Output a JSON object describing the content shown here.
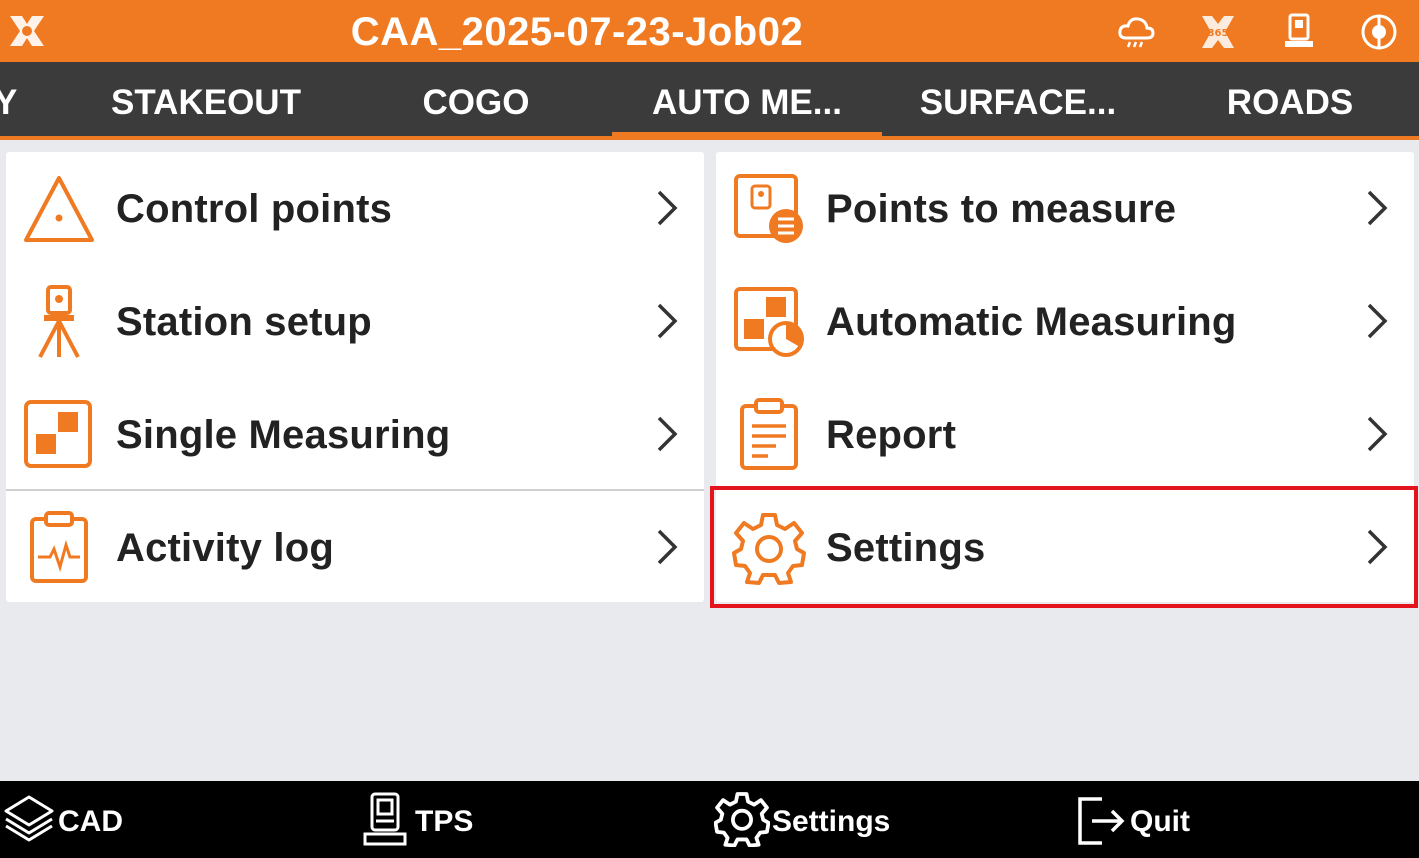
{
  "titlebar": {
    "title": "CAA_2025-07-23-Job02",
    "icons": [
      "app-logo-icon",
      "cloud-icon",
      "gnss-365-icon",
      "total-station-icon",
      "connection-status-icon"
    ],
    "colors": {
      "bar": "#f07a22",
      "text": "#ffffff"
    }
  },
  "tabs": {
    "items": [
      {
        "label": "Y"
      },
      {
        "label": "STAKEOUT"
      },
      {
        "label": "COGO"
      },
      {
        "label": "AUTO ME..."
      },
      {
        "label": "SURFACE..."
      },
      {
        "label": "ROADS"
      }
    ],
    "active": "AUTO ME...",
    "colors": {
      "bar": "#3b3b3b",
      "indicator": "#f07a22"
    }
  },
  "left_menu": {
    "items": [
      {
        "label": "Control points",
        "icon": "triangle-point-icon"
      },
      {
        "label": "Station setup",
        "icon": "tripod-icon"
      },
      {
        "label": "Single Measuring",
        "icon": "single-measure-icon"
      },
      {
        "label": "Activity log",
        "icon": "clipboard-pulse-icon"
      }
    ]
  },
  "right_menu": {
    "items": [
      {
        "label": "Points to measure",
        "icon": "points-list-icon"
      },
      {
        "label": "Automatic Measuring",
        "icon": "auto-measure-icon"
      },
      {
        "label": "Report",
        "icon": "report-icon"
      },
      {
        "label": "Settings",
        "icon": "gear-icon",
        "highlighted": true
      }
    ]
  },
  "bottombar": {
    "items": [
      {
        "label": "CAD",
        "icon": "layers-icon"
      },
      {
        "label": "TPS",
        "icon": "total-station-icon"
      },
      {
        "label": "Settings",
        "icon": "gear-icon"
      },
      {
        "label": "Quit",
        "icon": "exit-icon"
      }
    ]
  },
  "accent_color": "#f07a22",
  "highlight_color": "#e3141b"
}
